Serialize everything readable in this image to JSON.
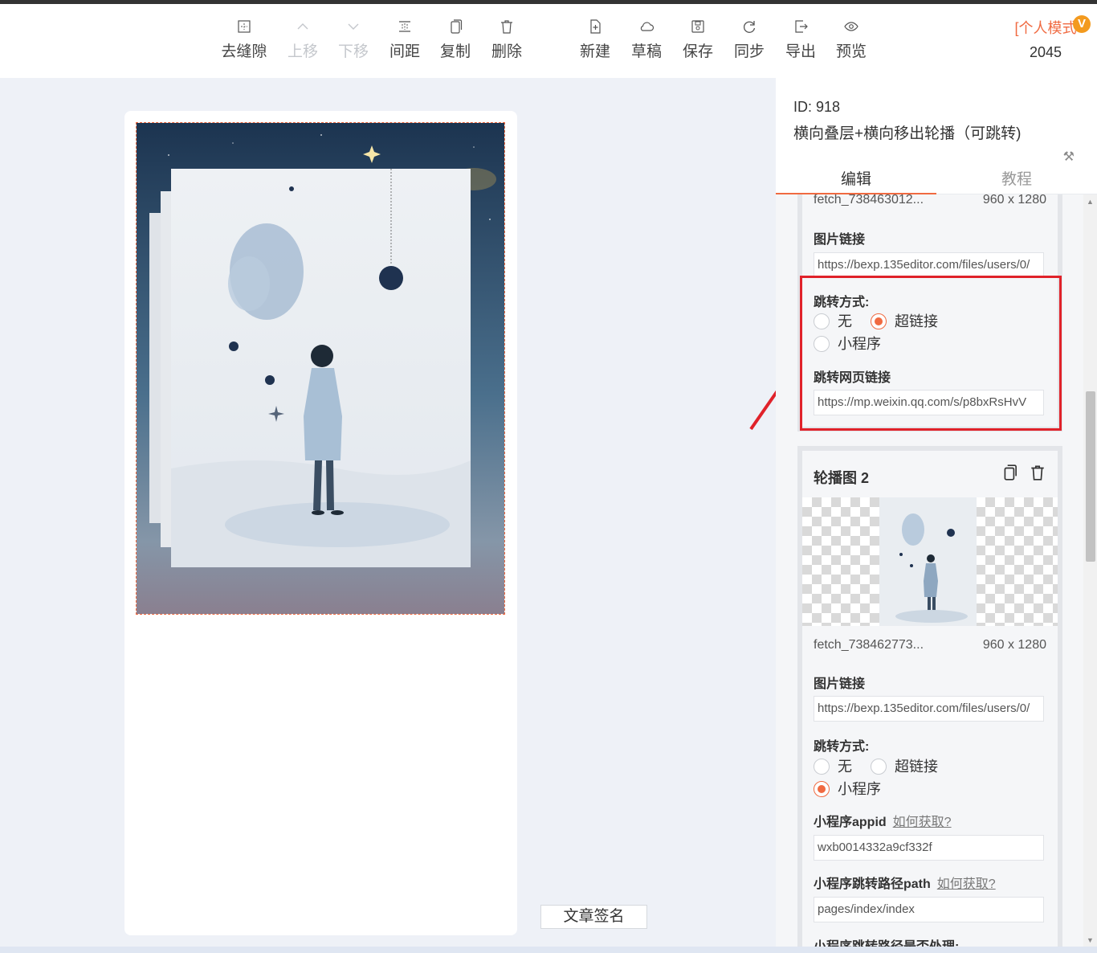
{
  "toolbar": {
    "items": [
      {
        "label": "去缝隙",
        "icon": "remove-gap-icon"
      },
      {
        "label": "上移",
        "icon": "chevron-up-icon"
      },
      {
        "label": "下移",
        "icon": "chevron-down-icon"
      },
      {
        "label": "间距",
        "icon": "spacing-icon"
      },
      {
        "label": "复制",
        "icon": "copy-icon"
      },
      {
        "label": "删除",
        "icon": "trash-icon"
      },
      {
        "label": "新建",
        "icon": "new-file-icon"
      },
      {
        "label": "草稿",
        "icon": "cloud-icon"
      },
      {
        "label": "保存",
        "icon": "save-icon"
      },
      {
        "label": "同步",
        "icon": "sync-icon"
      },
      {
        "label": "导出",
        "icon": "export-icon"
      },
      {
        "label": "预览",
        "icon": "eye-icon"
      }
    ],
    "mode_label": "[个人模式",
    "vip_badge": "V",
    "count": "2045"
  },
  "editor": {
    "signature_button": "文章签名"
  },
  "panel": {
    "id_text": "ID: 918",
    "template_name": "横向叠层+横向移出轮播（可跳转)",
    "tabs": [
      {
        "label": "编辑",
        "active": true
      },
      {
        "label": "教程",
        "active": false
      }
    ],
    "card1": {
      "filename": "fetch_738463012...",
      "size": "960 x 1280",
      "image_link_label": "图片链接",
      "image_link_value": "https://bexp.135editor.com/files/users/0/",
      "jump_mode_label": "跳转方式:",
      "jump_options": [
        "无",
        "超链接",
        "小程序"
      ],
      "jump_selected": "超链接",
      "web_link_label": "跳转网页链接",
      "web_link_value": "https://mp.weixin.qq.com/s/p8bxRsHvV"
    },
    "card2": {
      "title": "轮播图 2",
      "filename": "fetch_738462773...",
      "size": "960 x 1280",
      "image_link_label": "图片链接",
      "image_link_value": "https://bexp.135editor.com/files/users/0/",
      "jump_mode_label": "跳转方式:",
      "jump_options": [
        "无",
        "超链接",
        "小程序"
      ],
      "jump_selected": "小程序",
      "appid_label": "小程序appid",
      "help_link": "如何获取?",
      "appid_value": "wxb0014332a9cf332f",
      "path_label": "小程序跳转路径path",
      "path_value": "pages/index/index",
      "path_process_label": "小程序跳转路径是否处理:"
    }
  },
  "colors": {
    "accent": "#f06a41",
    "highlight": "#e0222a",
    "badge": "#f39a1e"
  }
}
